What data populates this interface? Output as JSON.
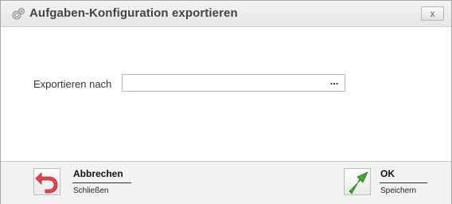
{
  "window": {
    "title": "Aufgaben-Konfiguration exportieren",
    "close_label": "x",
    "icon": "gears-icon"
  },
  "form": {
    "export_label": "Exportieren nach",
    "path_value": "",
    "path_placeholder": "",
    "browse_label": "..."
  },
  "footer": {
    "cancel": {
      "title": "Abbrechen",
      "subtitle": "Schließen",
      "icon": "undo-arrow-icon"
    },
    "ok": {
      "title": "OK",
      "subtitle": "Speichern",
      "icon": "green-arrow-icon"
    }
  },
  "colors": {
    "cancel_arrow": "#e0474f",
    "ok_arrow": "#43a833"
  }
}
